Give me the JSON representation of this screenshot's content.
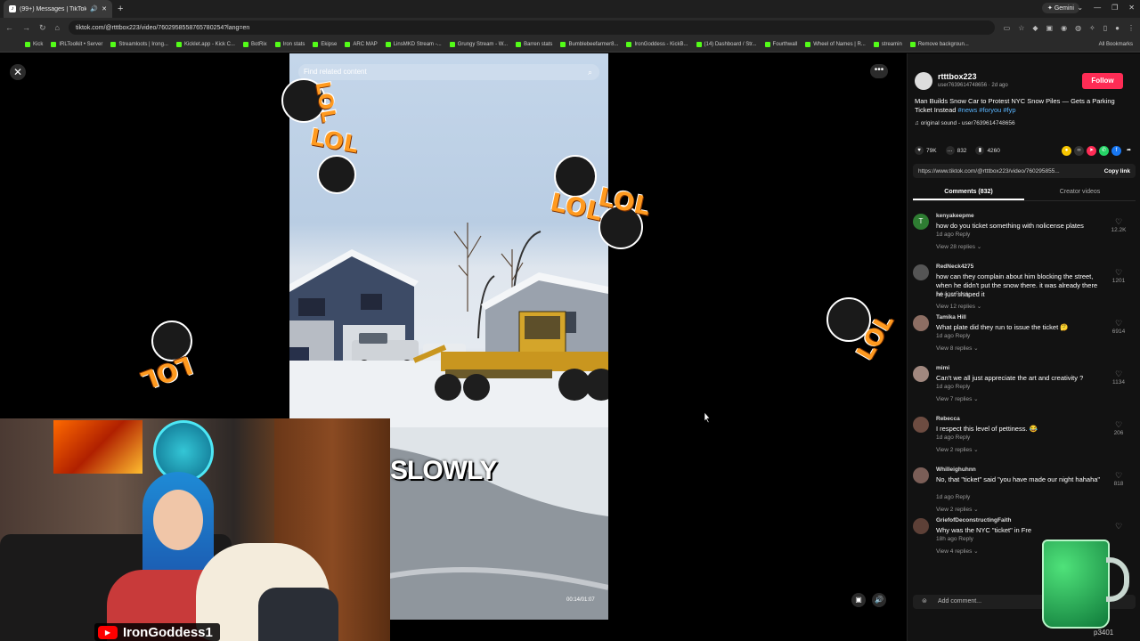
{
  "browser": {
    "tab_title": "(99+) Messages | TikTok",
    "url": "tiktok.com/@rtttbox223/video/7602958558765780254?lang=en",
    "gemini_label": "Gemini",
    "new_tab": "+",
    "bookmarks": [
      "Kick",
      "IRLToolkit • Server",
      "Streamloots | Irong...",
      "Kicklet.app - Kick C...",
      "BotRix",
      "Iron stats",
      "Ekipse",
      "ARC MAP",
      "LinsMKD Stream -...",
      "Grungy Stream - W...",
      "Barren stats",
      "Bumblebeefarmer8...",
      "IronGoddess - KickB...",
      "(14) Dashboard / Str...",
      "Fourthwall",
      "Wheel of Names | R...",
      "streamin",
      "Remove backgroun..."
    ],
    "all_bookmarks": "All Bookmarks"
  },
  "video": {
    "search_placeholder": "Find related content",
    "caption": "SLOWLY",
    "time": "00:14/01:07"
  },
  "overlays": {
    "lol_text": "LOL",
    "lol_vertical": "LOL",
    "stream_name": "IronGoddess1",
    "watermark": "p3401"
  },
  "post": {
    "username": "rtttbox223",
    "subline": "user7639614748656 · 2d ago",
    "follow_label": "Follow",
    "description": "Man Builds Snow Car to Protest NYC Snow Piles — Gets a Parking Ticket Instead",
    "hashtags": "#news #foryou #fyp",
    "sound": "original sound - user7639614748656",
    "likes": "79K",
    "comments_count": "832",
    "saves": "4260",
    "link": "https://www.tiktok.com/@rtttbox223/video/760295855...",
    "copy_link": "Copy link"
  },
  "tabs": {
    "comments": "Comments (832)",
    "creator_videos": "Creator videos"
  },
  "comments": [
    {
      "name": "kenyakeepme",
      "text": "how do you ticket something with nolicense plates",
      "meta": "1d ago   Reply",
      "replies": "View 28 replies",
      "likes": "12.2K",
      "color": "#2e7d32",
      "initial": "T"
    },
    {
      "name": "RedNeck4275",
      "text": "how can they complain about him blocking the street, when he didn't put the snow there. it was already there he just shaped it",
      "meta": "1d ago   Reply",
      "replies": "View 12 replies",
      "likes": "1201",
      "color": "#555555",
      "initial": ""
    },
    {
      "name": "Tamika Hill",
      "text": "What plate did they run to issue the ticket 🤔",
      "meta": "1d ago   Reply",
      "replies": "View 8 replies",
      "likes": "6914",
      "color": "#8d6e63",
      "initial": ""
    },
    {
      "name": "mimi",
      "text": "Can't we all just appreciate the art and creativity ?",
      "meta": "1d ago   Reply",
      "replies": "View 7 replies",
      "likes": "1134",
      "color": "#a1887f",
      "initial": ""
    },
    {
      "name": "Rebecca",
      "text": "I respect this level of pettiness. 😂",
      "meta": "1d ago   Reply",
      "replies": "View 2 replies",
      "likes": "206",
      "color": "#6d4c41",
      "initial": ""
    },
    {
      "name": "Whilleighuhnn",
      "text": "No, that \"ticket\" said \"you have made our night hahaha\"",
      "meta": "1d ago   Reply",
      "replies": "View 2 replies",
      "likes": "818",
      "color": "#7b5e57",
      "initial": ""
    },
    {
      "name": "GriefofDeconstructingFaith",
      "text": "Why was the NYC \"ticket\" in Fre",
      "meta": "18h ago   Reply",
      "replies": "View 4 replies",
      "likes": "",
      "color": "#5d4037",
      "initial": ""
    }
  ],
  "add_comment": "Add comment..."
}
